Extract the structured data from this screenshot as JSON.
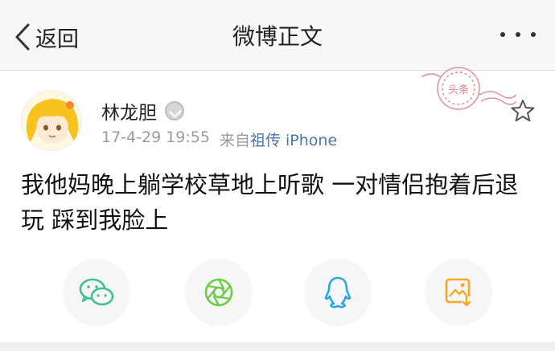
{
  "nav": {
    "back_label": "返回",
    "title": "微博正文"
  },
  "post": {
    "author_name": "林龙胆",
    "timestamp": "17-4-29 19:55",
    "source_prefix": "来自",
    "source_link": "祖传 iPhone",
    "content": "我他妈晚上躺学校草地上听歌 一对情侣抱着后退玩 踩到我脸上",
    "stamp_text": "头条"
  },
  "share": {
    "items": [
      {
        "icon": "wechat-icon",
        "color": "#3fc28b"
      },
      {
        "icon": "moments-icon",
        "color": "#6ccc4a"
      },
      {
        "icon": "qq-icon",
        "color": "#2aa6e0"
      },
      {
        "icon": "save-image-icon",
        "color": "#f5a623"
      }
    ]
  },
  "colors": {
    "link": "#4d75a8",
    "meta_gray": "#9b9b9b",
    "stamp_red": "#d9858b"
  }
}
